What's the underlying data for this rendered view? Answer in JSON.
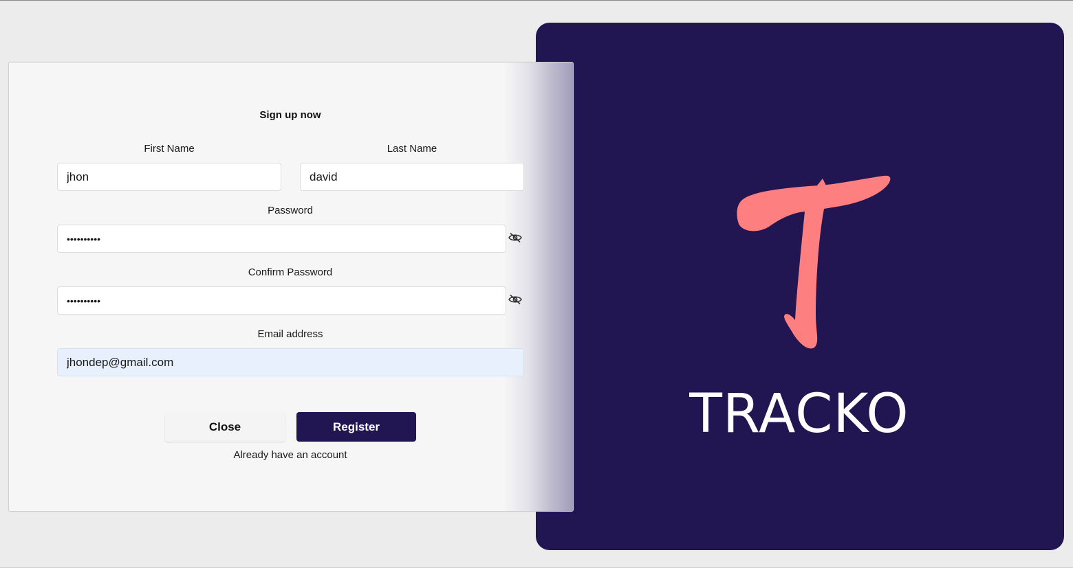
{
  "form": {
    "title": "Sign up now",
    "first_name": {
      "label": "First Name",
      "value": "jhon"
    },
    "last_name": {
      "label": "Last Name",
      "value": "david"
    },
    "password": {
      "label": "Password",
      "value": "••••••••••"
    },
    "confirm_password": {
      "label": "Confirm Password",
      "value": "••••••••••"
    },
    "email": {
      "label": "Email address",
      "value": "jhondep@gmail.com"
    },
    "close_label": "Close",
    "register_label": "Register",
    "login_link": "Already have an account"
  },
  "brand": {
    "name": "TRACKO",
    "logo_icon": "tracko-t-logo-icon",
    "panel_color": "#211651",
    "accent_color": "#fe7f7f"
  },
  "icons": {
    "password_toggle": "eye-slash-icon",
    "confirm_password_toggle": "eye-slash-icon"
  }
}
